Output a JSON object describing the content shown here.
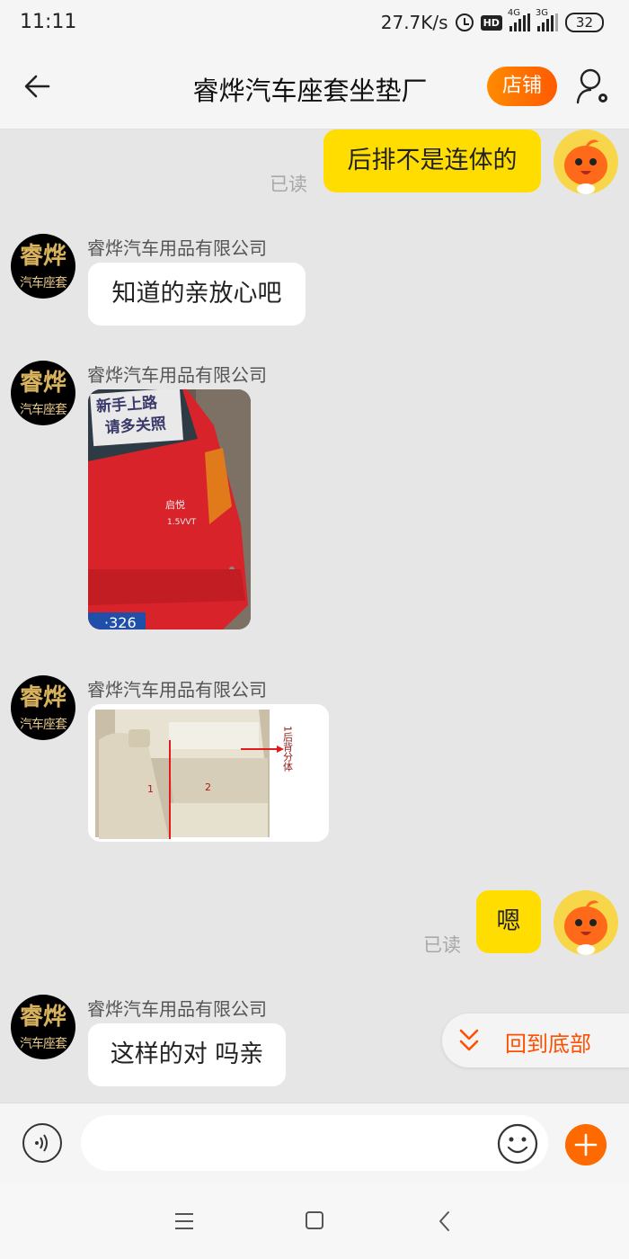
{
  "status_bar": {
    "time": "11:11",
    "speed": "27.7K/s",
    "hd": "HD",
    "net1": "4G",
    "net2": "3G",
    "battery": "32"
  },
  "header": {
    "title": "睿烨汽车座套坐垫厂",
    "store_label": "店铺"
  },
  "shop_avatar": {
    "line1": "睿烨",
    "line2": "汽车座套"
  },
  "messages": [
    {
      "from": "me",
      "text": "后排不是连体的",
      "read": "已读"
    },
    {
      "from": "shop",
      "sender": "睿烨汽车用品有限公司",
      "text": "知道的亲放心吧"
    },
    {
      "from": "shop",
      "sender": "睿烨汽车用品有限公司",
      "image": {
        "sign_line1": "新手上路",
        "sign_line2": "请多关照",
        "badge": "启悦",
        "model": "1.5VVT",
        "plate": "·326"
      }
    },
    {
      "from": "shop",
      "sender": "睿烨汽车用品有限公司",
      "image": {
        "label": "1后背分体",
        "n1": "1",
        "n2": "2"
      }
    },
    {
      "from": "me",
      "text": "嗯",
      "read": "已读"
    },
    {
      "from": "shop",
      "sender": "睿烨汽车用品有限公司",
      "text": "这样的对 吗亲"
    }
  ],
  "back_to_bottom": "回到底部",
  "input": {
    "placeholder": ""
  },
  "colors": {
    "accent": "#ff5000",
    "my_bubble": "#ffdd00",
    "background": "#e6e6e6"
  }
}
